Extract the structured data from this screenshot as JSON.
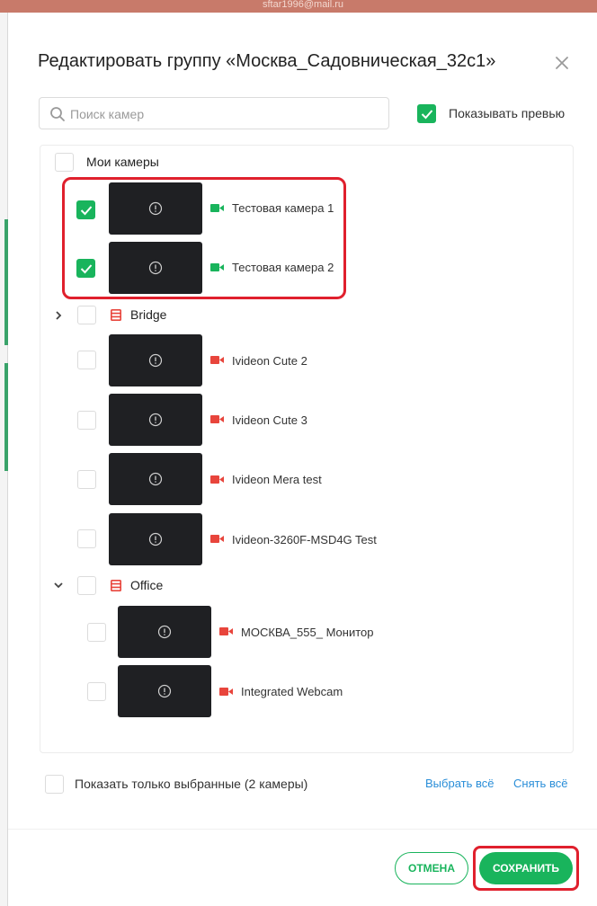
{
  "background": {
    "email": "sftar1996@mail.ru"
  },
  "dialog": {
    "title": "Редактировать группу «Москва_Садовническая_32с1»",
    "search": {
      "placeholder": "Поиск камер",
      "value": ""
    },
    "show_preview": {
      "label": "Показывать превью",
      "checked": true
    },
    "groups": [
      {
        "name": "Мои камеры",
        "checked": false,
        "cameras": [
          {
            "name": "Тестовая камера 1",
            "checked": true,
            "status": "online"
          },
          {
            "name": "Тестовая камера 2",
            "checked": true,
            "status": "online"
          }
        ]
      },
      {
        "name": "Bridge",
        "checked": false,
        "expanded": false,
        "icon": "server-icon"
      },
      {
        "name": "",
        "cameras": [
          {
            "name": "Ivideon Cute 2",
            "checked": false,
            "status": "offline"
          },
          {
            "name": "Ivideon Cute 3",
            "checked": false,
            "status": "offline"
          },
          {
            "name": "Ivideon Mera test",
            "checked": false,
            "status": "offline"
          },
          {
            "name": "Ivideon-3260F-MSD4G Test",
            "checked": false,
            "status": "offline"
          }
        ]
      },
      {
        "name": "Office",
        "checked": false,
        "expanded": true,
        "icon": "server-icon",
        "cameras": [
          {
            "name": "МОСКВА_555_ Монитор",
            "checked": false,
            "status": "offline"
          },
          {
            "name": "Integrated Webcam",
            "checked": false,
            "status": "offline"
          }
        ]
      }
    ],
    "footer": {
      "only_selected_label": "Показать только выбранные (2 камеры)",
      "only_selected_checked": false,
      "select_all": "Выбрать всё",
      "deselect_all": "Снять всё"
    },
    "buttons": {
      "cancel": "ОТМЕНА",
      "save": "СОХРАНИТЬ"
    }
  },
  "colors": {
    "accent_green": "#19b45c",
    "link_blue": "#2a8ed8",
    "camera_online": "#19b45c",
    "camera_offline": "#e8453c",
    "highlight_red": "#e0202d"
  }
}
